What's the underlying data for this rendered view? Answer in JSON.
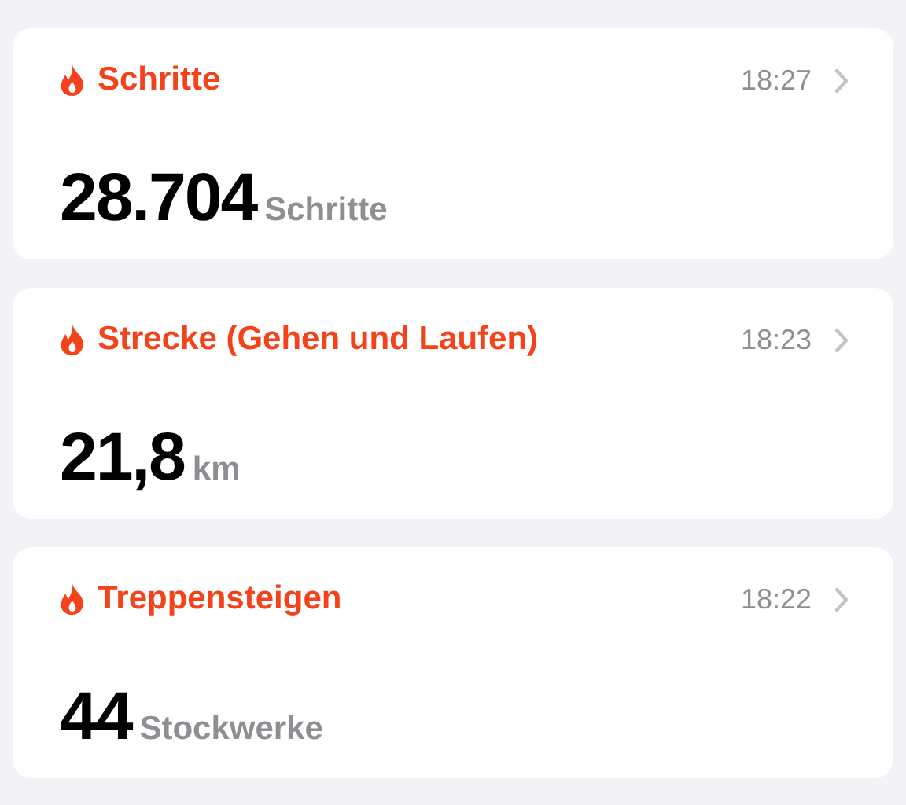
{
  "cards": [
    {
      "title": "Schritte",
      "time": "18:27",
      "value": "28.704",
      "unit": "Schritte"
    },
    {
      "title": "Strecke (Gehen und Laufen)",
      "time": "18:23",
      "value": "21,8",
      "unit": "km"
    },
    {
      "title": "Treppensteigen",
      "time": "18:22",
      "value": "44",
      "unit": "Stockwerke"
    }
  ]
}
